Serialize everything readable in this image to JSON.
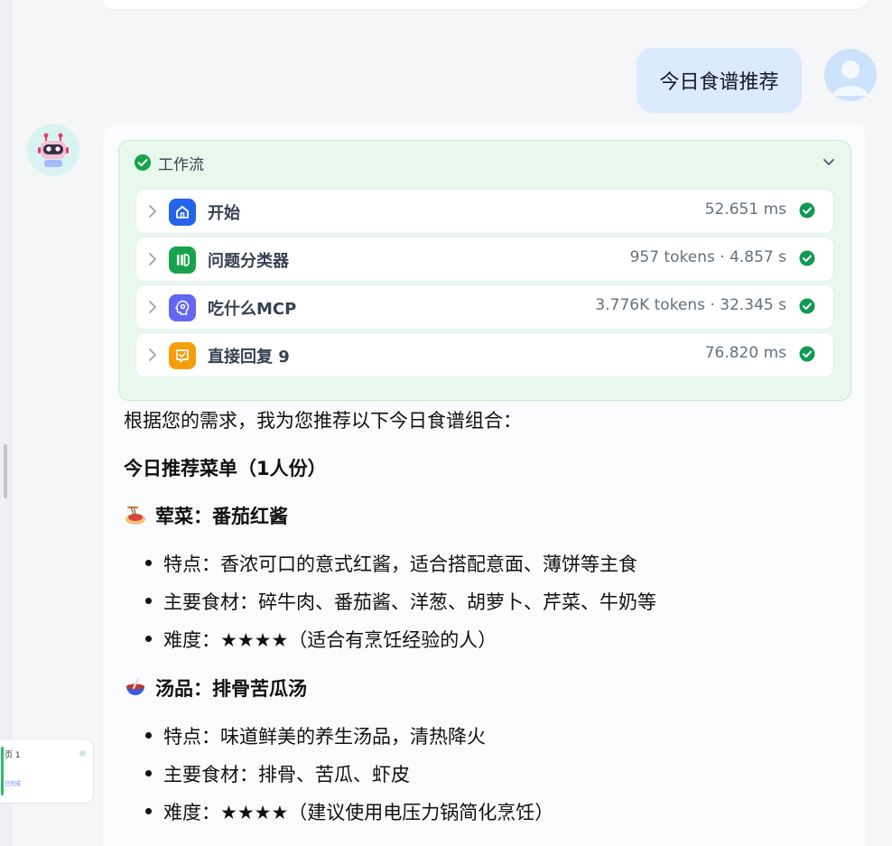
{
  "mini_node": {
    "line1": "页 1",
    "line2": "已完成"
  },
  "user": {
    "message": "今日食谱推荐"
  },
  "workflow": {
    "title": "工作流",
    "steps": [
      {
        "name": "开始",
        "meta": "52.651 ms",
        "icon": "home-icon",
        "color": "#2563eb"
      },
      {
        "name": "问题分类器",
        "meta": "957 tokens · 4.857 s",
        "icon": "classifier-icon",
        "color": "#16a34a"
      },
      {
        "name": "吃什么MCP",
        "meta": "3.776K tokens · 32.345 s",
        "icon": "brain-gear-icon",
        "color": "#6366f1"
      },
      {
        "name": "直接回复 9",
        "meta": "76.820 ms",
        "icon": "reply-icon",
        "color": "#f59e0b"
      }
    ]
  },
  "answer": {
    "intro": "根据您的需求，我为您推荐以下今日食谱组合：",
    "menu_title": "今日推荐菜单（1人份）",
    "dish1": {
      "title": "荤菜：番茄红酱",
      "icon": "spaghetti-icon",
      "items": [
        "特点：香浓可口的意式红酱，适合搭配意面、薄饼等主食",
        "主要食材：碎牛肉、番茄酱、洋葱、胡萝卜、芹菜、牛奶等",
        "难度：★★★★（适合有烹饪经验的人）"
      ]
    },
    "dish2": {
      "title": "汤品：排骨苦瓜汤",
      "icon": "soup-bowl-icon",
      "items": [
        "特点：味道鲜美的养生汤品，清热降火",
        "主要食材：排骨、苦瓜、虾皮",
        "难度：★★★★（建议使用电压力锅简化烹饪）"
      ]
    }
  }
}
